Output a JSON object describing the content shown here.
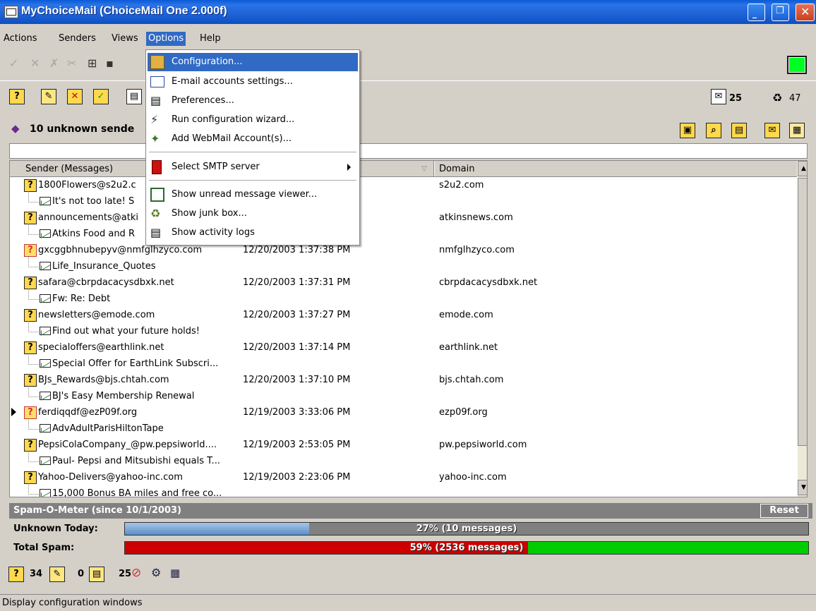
{
  "window": {
    "title": "MyChoiceMail (ChoiceMail One 2.000f)"
  },
  "menubar": [
    "Actions",
    "Senders",
    "Views",
    "Options",
    "Help"
  ],
  "options_menu": {
    "items": [
      {
        "label": "Configuration...",
        "icon": "configuration-icon"
      },
      {
        "label": "E-mail accounts settings...",
        "icon": "email-accounts-icon"
      },
      {
        "label": "Preferences...",
        "icon": "preferences-icon"
      },
      {
        "label": "Run configuration wizard...",
        "icon": "wizard-icon"
      },
      {
        "label": "Add WebMail Account(s)...",
        "icon": "webmail-icon"
      },
      {
        "label": "Select SMTP server",
        "icon": "smtp-server-icon"
      },
      {
        "label": "Show unread message viewer...",
        "icon": "unread-viewer-icon"
      },
      {
        "label": "Show junk box...",
        "icon": "junk-box-icon"
      },
      {
        "label": "Show activity logs",
        "icon": "activity-logs-icon"
      }
    ]
  },
  "counts": {
    "unread": "25",
    "junk": "47"
  },
  "header": {
    "unknown_label": "10 unknown sende"
  },
  "columns": {
    "sender": "Sender (Messages)",
    "domain": "Domain"
  },
  "senders": [
    {
      "email": "1800Flowers@s2u2.c",
      "date": "",
      "domain": "s2u2.com",
      "subject": "It's not too late! S",
      "bcc": false
    },
    {
      "email": "announcements@atki",
      "date": "",
      "domain": "atkinsnews.com",
      "subject": "Atkins Food and R",
      "bcc": false
    },
    {
      "email": "gxcggbhnubepyv@nmfglhzyco.com",
      "date": "12/20/2003 1:37:38 PM",
      "domain": "nmfglhzyco.com",
      "subject": "Life_Insurance_Quotes",
      "bcc": true
    },
    {
      "email": "safara@cbrpdacacysdbxk.net",
      "date": "12/20/2003 1:37:31 PM",
      "domain": "cbrpdacacysdbxk.net",
      "subject": "Fw: Re: Debt",
      "bcc": false
    },
    {
      "email": "newsletters@emode.com",
      "date": "12/20/2003 1:37:27 PM",
      "domain": "emode.com",
      "subject": "Find out what your future holds!",
      "bcc": false
    },
    {
      "email": "specialoffers@earthlink.net",
      "date": "12/20/2003 1:37:14 PM",
      "domain": "earthlink.net",
      "subject": "Special Offer for EarthLink Subscri...",
      "bcc": false
    },
    {
      "email": "BJs_Rewards@bjs.chtah.com",
      "date": "12/20/2003 1:37:10 PM",
      "domain": "bjs.chtah.com",
      "subject": "BJ's Easy Membership Renewal",
      "bcc": false
    },
    {
      "email": "ferdiqqdf@ezP09f.org",
      "date": "12/19/2003 3:33:06 PM",
      "domain": "ezp09f.org",
      "subject": "AdvAdultParisHiltonTape",
      "bcc": true
    },
    {
      "email": "PepsiColaCompany_@pw.pepsiworld....",
      "date": "12/19/2003 2:53:05 PM",
      "domain": "pw.pepsiworld.com",
      "subject": "Paul- Pepsi and Mitsubishi equals T...",
      "bcc": false
    },
    {
      "email": "Yahoo-Delivers@yahoo-inc.com",
      "date": "12/19/2003 2:23:06 PM",
      "domain": "yahoo-inc.com",
      "subject": "15,000 Bonus BA miles and free co...",
      "bcc": false
    }
  ],
  "spam_meter": {
    "title": "Spam-O-Meter (since 10/1/2003)",
    "reset": "Reset",
    "unknown_label": "Unknown Today:",
    "unknown_text": "27% (10 messages)",
    "unknown_pct": 27,
    "total_label": "Total Spam:",
    "total_text": "59% (2536 messages)",
    "total_pct": 59
  },
  "bottom": {
    "unknown": "34",
    "pending": "0",
    "messages": "25"
  },
  "status": "Display configuration windows",
  "colors": {
    "title_blue": "#0a5bd6",
    "highlight": "#316ac5",
    "spam_red": "#cc0000",
    "spam_green": "#00cc00",
    "unknown_blue": "#6a9fd6"
  }
}
